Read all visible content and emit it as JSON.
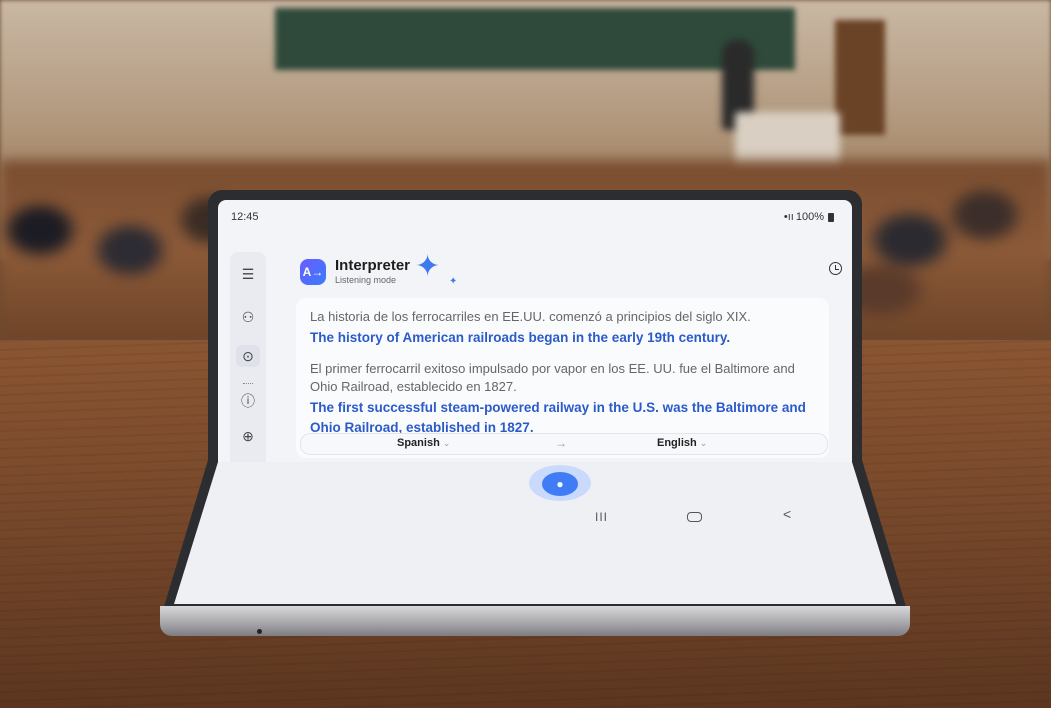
{
  "status_bar": {
    "time": "12:45",
    "signal_icons": "•ıı",
    "battery": "100%"
  },
  "app": {
    "name": "Interpreter",
    "mode": "Listening mode",
    "logo_glyph": "A→"
  },
  "rail": {
    "menu_icon": "☰",
    "chat_icon": "⚇",
    "conversation_icon": "⊙",
    "info_icon": "ⓘ",
    "add_icon": "⊕"
  },
  "transcript": [
    {
      "source": "La historia de los ferrocarriles en EE.UU. comenzó a principios del siglo XIX.",
      "translation": "The history of American railroads began in the early 19th century."
    },
    {
      "source": "El primer ferrocarril exitoso impulsado por vapor en los EE. UU. fue el Baltimore and Ohio Railroad, establecido en 1827.",
      "translation": "The first successful steam-powered railway in the U.S. was the Baltimore and Ohio Railroad, established in 1827."
    }
  ],
  "languages": {
    "source": "Spanish",
    "target": "English",
    "arrow": "→",
    "chevron": "⌄"
  },
  "nav": {
    "recent": "III",
    "back": "<"
  },
  "colors": {
    "accent": "#3f7cf5",
    "translation_text": "#2b5bc9",
    "source_text": "#666666"
  }
}
